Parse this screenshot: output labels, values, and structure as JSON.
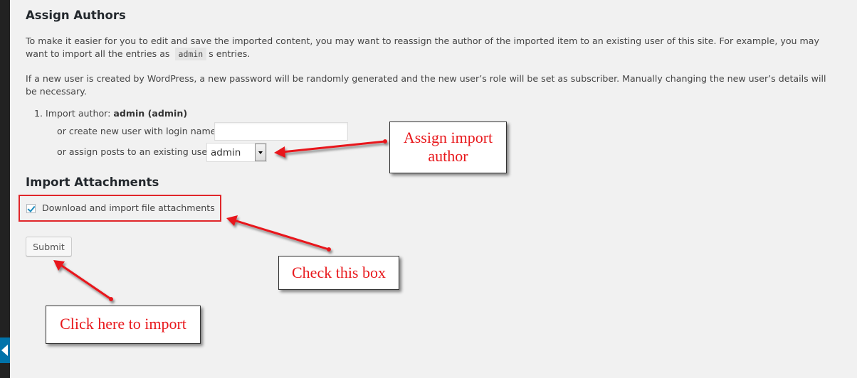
{
  "assign_authors": {
    "title": "Assign Authors",
    "para1_before": "To make it easier for you to edit and save the imported content, you may want to reassign the author of the imported item to an existing user of this site. For example, you may want to import all the entries as",
    "para1_code": "admin",
    "para1_after": "s entries.",
    "para2": "If a new user is created by WordPress, a new password will be randomly generated and the new user’s role will be set as subscriber. Manually changing the new user’s details will be necessary.",
    "author_item_prefix": "1. Import author:",
    "author_item_name": "admin (admin)",
    "new_user_label": "or create new user with login name:",
    "new_user_value": "",
    "new_user_placeholder": "",
    "existing_user_label": "or assign posts to an existing user:",
    "existing_user_selected": "admin"
  },
  "import_attachments": {
    "title": "Import Attachments",
    "checkbox_label": "Download and import file attachments",
    "checkbox_checked": true
  },
  "submit_label": "Submit",
  "callouts": {
    "assign": [
      "Assign import",
      "author"
    ],
    "check": "Check this box",
    "click": "Click here to import"
  },
  "colors": {
    "annotation_red": "#e8181c",
    "highlight_border": "#e0262a",
    "sidebar": "#222222",
    "collapse_accent": "#0073aa",
    "page_bg": "#f1f1f1"
  },
  "icons": {
    "collapse": "collapse-arrow-icon",
    "checkbox": "checkmark-icon",
    "select": "dropdown-arrow-icon"
  }
}
